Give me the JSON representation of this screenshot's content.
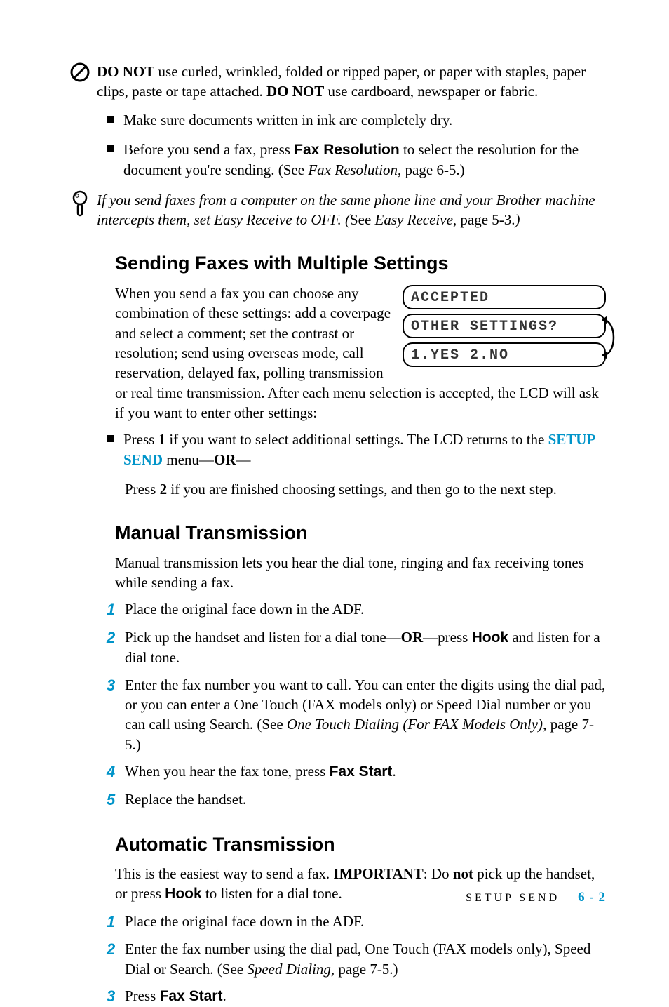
{
  "warn": {
    "donot_prefix": "DO NOT",
    "donot_text1": " use curled, wrinkled, folded or ripped paper, or paper with staples, paper clips, paste or tape attached. ",
    "donot_prefix2": "DO NOT",
    "donot_text2": " use cardboard, newspaper or fabric."
  },
  "bullets1": {
    "b1": "Make sure documents written in ink are completely dry.",
    "b2_pre": "Before you send a fax, press ",
    "b2_btn": "Fax Resolution",
    "b2_mid": " to select the resolution for the document you're sending. (See ",
    "b2_ref": "Fax Resolution",
    "b2_post": ", page 6-5.)"
  },
  "note": {
    "pre": "If you send faxes from a computer on the same phone line and your Brother machine intercepts them, set Easy Receive to OFF. (",
    "see": "See ",
    "ref": "Easy Receive",
    "post": ", page 5-3.",
    "close": ")"
  },
  "sec1": {
    "title": "Sending Faxes with Multiple Settings",
    "body": "When you send a fax you can choose any combination of these settings:  add a coverpage and select a comment; set the contrast or resolution; send using overseas mode, call reservation, delayed fax, polling transmission or real time transmission. After each menu selection is accepted, the LCD will ask if you want to enter other settings:",
    "lcd1": "ACCEPTED",
    "lcd2": "OTHER SETTINGS?",
    "lcd3": "1.YES 2.NO",
    "bullet_pre": "Press ",
    "bullet_1": "1",
    "bullet_mid": " if you want to select additional settings. The LCD returns to the ",
    "bullet_ss": "SETUP SEND",
    "bullet_menu": " menu—",
    "bullet_or": "OR",
    "bullet_dash": "—",
    "bullet2_pre": "Press ",
    "bullet2_2": "2",
    "bullet2_post": " if you are finished choosing settings, and then go to the next step."
  },
  "sec2": {
    "title": "Manual Transmission",
    "intro": "Manual transmission lets you hear the dial tone, ringing and fax receiving tones while sending a fax.",
    "s1": "Place the original face down in the ADF.",
    "s2_pre": "Pick up the handset and listen for a dial tone—",
    "s2_or": "OR",
    "s2_mid": "—press ",
    "s2_hook": "Hook",
    "s2_post": " and listen for a dial tone.",
    "s3_pre": "Enter the fax number you want to call. You can enter the digits using the dial pad, or you can enter a One Touch (FAX models only) or Speed Dial number or you can call using Search. (See ",
    "s3_ref": "One Touch Dialing (For FAX Models Only)",
    "s3_post": ", page 7-5.)",
    "s4_pre": "When you hear the fax tone, press ",
    "s4_btn": "Fax Start",
    "s4_post": ".",
    "s5": "Replace the handset."
  },
  "sec3": {
    "title": "Automatic Transmission",
    "intro_pre": "This is the easiest way to send a fax. ",
    "intro_imp": "IMPORTANT",
    "intro_mid": ": Do ",
    "intro_not": "not",
    "intro_mid2": " pick up the handset, or press ",
    "intro_hook": "Hook",
    "intro_post": " to listen for a dial tone.",
    "s1": "Place the original face down in the ADF.",
    "s2_pre": "Enter the fax number using the dial pad, One Touch (FAX models only), Speed Dial or Search. (See ",
    "s2_ref": "Speed Dialing",
    "s2_post": ", page 7-5.)",
    "s3_pre": "Press ",
    "s3_btn": "Fax Start",
    "s3_post": "."
  },
  "footer": {
    "section": "SETUP SEND",
    "page": "6 - 2"
  }
}
